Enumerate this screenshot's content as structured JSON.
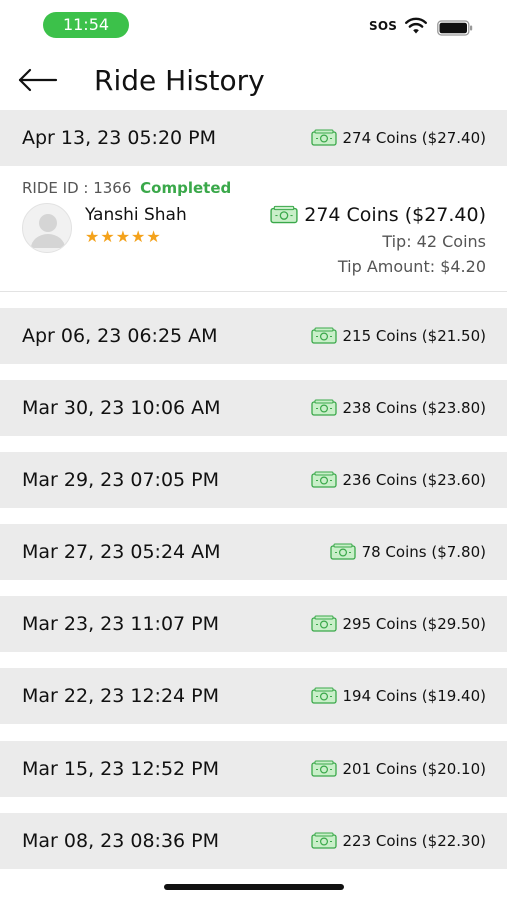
{
  "status_bar": {
    "time": "11:54",
    "sos": "SOS",
    "accent_color": "#3cc14a"
  },
  "header": {
    "back_icon": "arrow-left-icon",
    "title": "Ride History"
  },
  "rides": [
    {
      "date": "Apr 13, 23 05:20 PM",
      "amount": "274 Coins ($27.40)"
    },
    {
      "date": "Apr 06, 23 06:25 AM",
      "amount": "215 Coins ($21.50)"
    },
    {
      "date": "Mar 30, 23 10:06 AM",
      "amount": "238 Coins ($23.80)"
    },
    {
      "date": "Mar 29, 23 07:05 PM",
      "amount": "236 Coins ($23.60)"
    },
    {
      "date": "Mar 27, 23 05:24 AM",
      "amount": "78 Coins ($7.80)"
    },
    {
      "date": "Mar 23, 23 11:07 PM",
      "amount": "295 Coins ($29.50)"
    },
    {
      "date": "Mar 22, 23 12:24 PM",
      "amount": "194 Coins ($19.40)"
    },
    {
      "date": "Mar 15, 23 12:52 PM",
      "amount": "201 Coins ($20.10)"
    },
    {
      "date": "Mar 08, 23 08:36 PM",
      "amount": "223 Coins ($22.30)"
    }
  ],
  "detail": {
    "ride_id": "RIDE ID : 1366",
    "status": "Completed",
    "status_color": "#3aa84a",
    "driver_name": "Yanshi Shah",
    "rating": 5,
    "amount": "274 Coins ($27.40)",
    "tip": "Tip: 42 Coins",
    "tip_amount": "Tip Amount: $4.20"
  },
  "icons": {
    "coin": "coins-icon",
    "avatar": "user-avatar-icon",
    "star": "star-icon"
  }
}
